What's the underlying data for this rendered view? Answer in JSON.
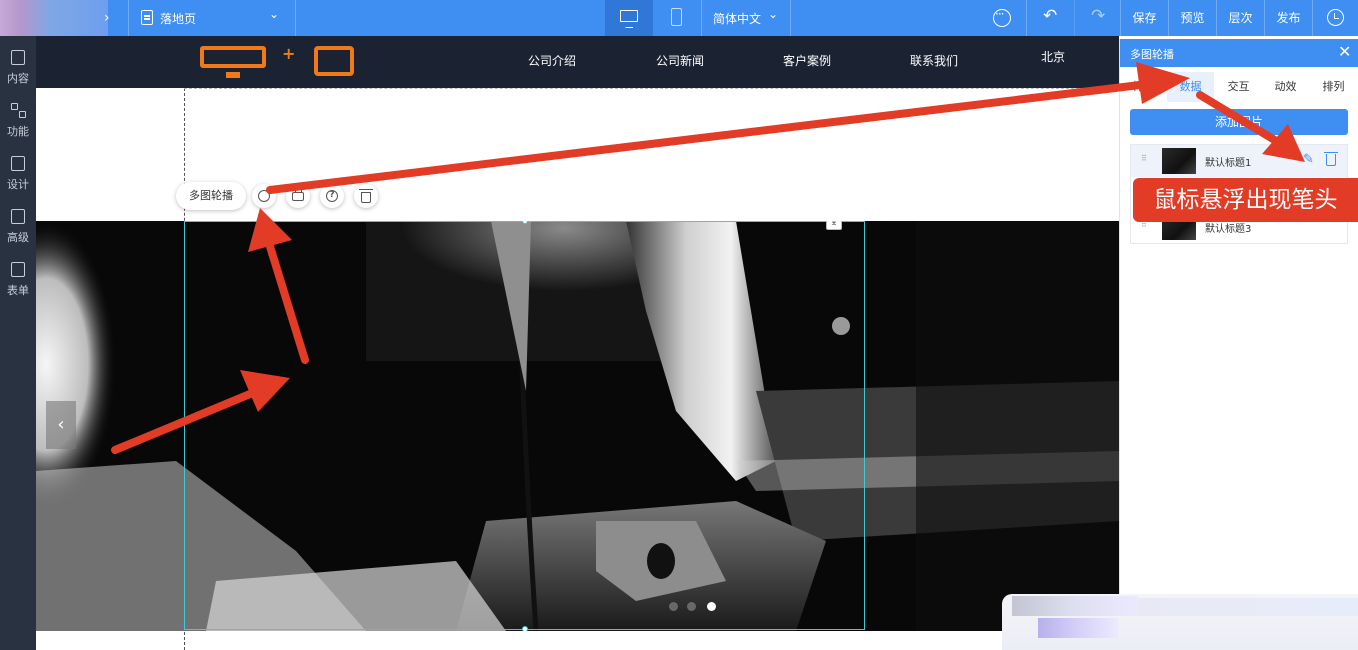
{
  "toolbar": {
    "page_selector": "落地页",
    "language_selector": "简体中文",
    "save": "保存",
    "preview": "预览",
    "layers": "层次",
    "publish": "发布",
    "icons": [
      "forward-arrow-icon",
      "page-icon",
      "chevron-down-icon",
      "desktop-icon",
      "mobile-icon",
      "more-icon",
      "undo-icon",
      "redo-icon",
      "history-icon"
    ]
  },
  "sidebar": {
    "items": [
      {
        "label": "内容",
        "icon": "document-icon"
      },
      {
        "label": "功能",
        "icon": "grid-icon"
      },
      {
        "label": "设计",
        "icon": "layout-icon"
      },
      {
        "label": "高级",
        "icon": "code-icon"
      },
      {
        "label": "表单",
        "icon": "form-icon"
      }
    ]
  },
  "site": {
    "nav": [
      "公司介绍",
      "公司新闻",
      "客户案例",
      "联系我们",
      "北京"
    ]
  },
  "floatbar": {
    "label": "多图轮播"
  },
  "panel": {
    "title": "多图轮播",
    "tabs": [
      "样式",
      "数据",
      "交互",
      "动效",
      "排列"
    ],
    "active_tab": "数据",
    "add_button": "添加图片",
    "items": [
      "默认标题1",
      "默认标题3"
    ]
  },
  "callout": {
    "text": "鼠标悬浮出现笔头"
  },
  "colors": {
    "accent": "#3f8ef1",
    "sidebar": "#293241",
    "site_nav": "#1b2333",
    "logo": "#f07a1a",
    "annotation": "#e23b26",
    "selection": "#40c9d9"
  }
}
